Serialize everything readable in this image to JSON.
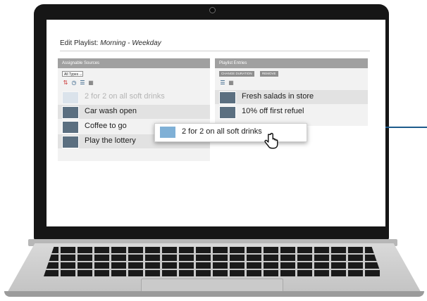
{
  "page_title_prefix": "Edit Playlist: ",
  "page_title_name": "Morning - Weekday",
  "left_panel": {
    "header": "Assignable Sources",
    "filter_value": "All Types",
    "items": [
      {
        "label": "2 for 2 on all soft drinks"
      },
      {
        "label": "Car wash open"
      },
      {
        "label": "Coffee to go"
      },
      {
        "label": "Play the lottery"
      }
    ]
  },
  "right_panel": {
    "header": "Playlist Entries",
    "change_duration": "CHANGE DURATION",
    "remove": "REMOVE",
    "items": [
      {
        "label": "Fresh salads in store"
      },
      {
        "label": "10% off first refuel"
      }
    ]
  },
  "drag_item": {
    "label": "2 for 2 on all soft drinks"
  },
  "colors": {
    "accent_line": "#1e5b8c",
    "panel_header": "#a0a0a0"
  },
  "icons": [
    "sort-az-icon",
    "clock-icon",
    "list-view-icon",
    "grid-view-icon",
    "hand-cursor-icon",
    "camera-icon"
  ]
}
